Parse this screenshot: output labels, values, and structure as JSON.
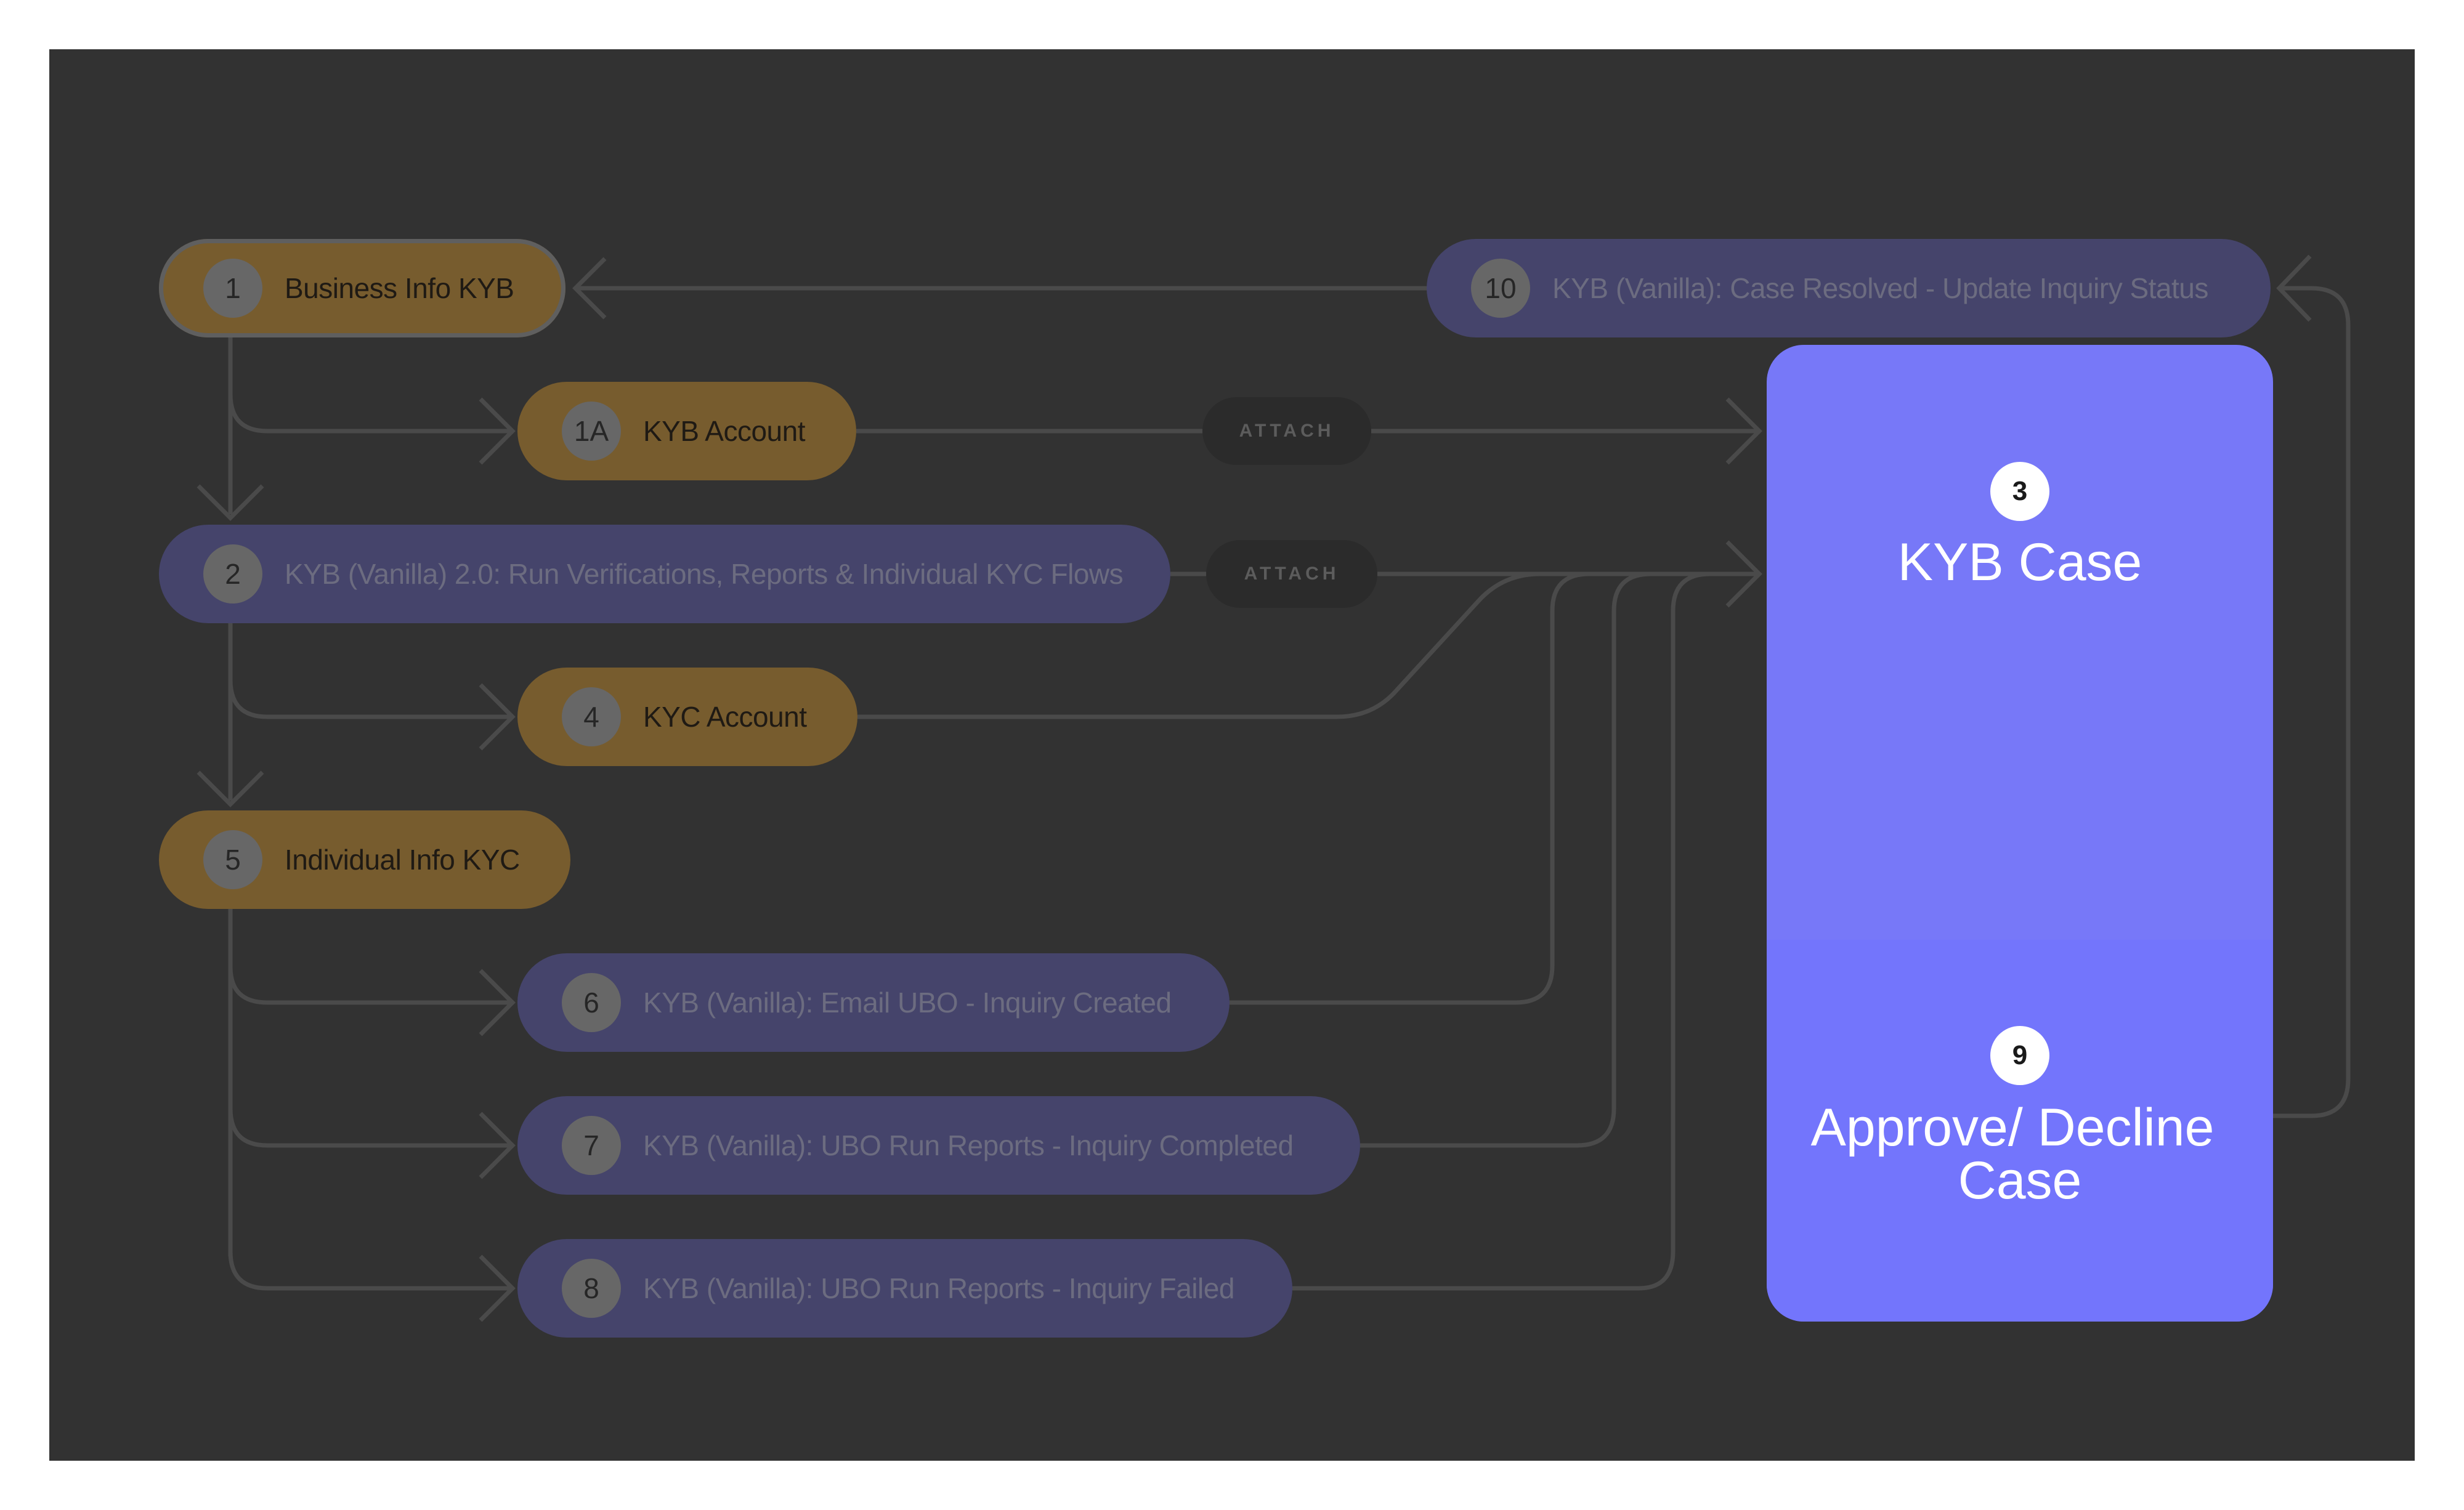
{
  "colors": {
    "canvas": "#323232",
    "orange_node": "#775c2e",
    "purple_node": "#45446b",
    "case_card": "#7778f8",
    "connector": "#4a4a4a"
  },
  "nodes": {
    "n1": {
      "num": "1",
      "label": "Business Info KYB"
    },
    "n1a": {
      "num": "1A",
      "label": "KYB Account"
    },
    "n2": {
      "num": "2",
      "label": "KYB (Vanilla) 2.0: Run Verifications, Reports & Individual KYC Flows"
    },
    "n4": {
      "num": "4",
      "label": "KYC Account"
    },
    "n5": {
      "num": "5",
      "label": "Individual Info KYC"
    },
    "n6": {
      "num": "6",
      "label": "KYB (Vanilla): Email UBO - Inquiry Created"
    },
    "n7": {
      "num": "7",
      "label": "KYB (Vanilla): UBO Run Reports - Inquiry Completed"
    },
    "n8": {
      "num": "8",
      "label": "KYB (Vanilla): UBO Run Reports - Inquiry Failed"
    },
    "n10": {
      "num": "10",
      "label": "KYB (Vanilla): Case Resolved - Update Inquiry Status"
    }
  },
  "attach_labels": [
    "ATTACH",
    "ATTACH"
  ],
  "case": {
    "top_num": "3",
    "top_label": "KYB Case",
    "bottom_num": "9",
    "bottom_label_line1": "Approve/ Decline",
    "bottom_label_line2": "Case"
  }
}
